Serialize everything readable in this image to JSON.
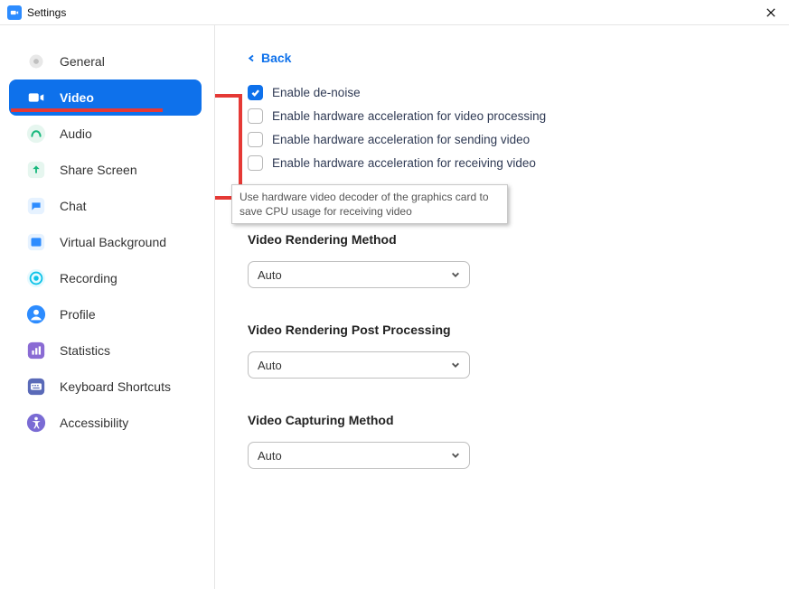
{
  "window": {
    "title": "Settings"
  },
  "sidebar": {
    "items": [
      {
        "label": "General",
        "icon": "gear"
      },
      {
        "label": "Video",
        "icon": "video",
        "active": true
      },
      {
        "label": "Audio",
        "icon": "audio"
      },
      {
        "label": "Share Screen",
        "icon": "share"
      },
      {
        "label": "Chat",
        "icon": "chat"
      },
      {
        "label": "Virtual Background",
        "icon": "vbg"
      },
      {
        "label": "Recording",
        "icon": "record"
      },
      {
        "label": "Profile",
        "icon": "profile"
      },
      {
        "label": "Statistics",
        "icon": "stats"
      },
      {
        "label": "Keyboard Shortcuts",
        "icon": "keyboard"
      },
      {
        "label": "Accessibility",
        "icon": "accessibility"
      }
    ]
  },
  "main": {
    "back_label": "Back",
    "checkboxes": [
      {
        "label": "Enable de-noise",
        "checked": true
      },
      {
        "label": "Enable hardware acceleration for video processing",
        "checked": false
      },
      {
        "label": "Enable hardware acceleration for sending video",
        "checked": false
      },
      {
        "label": "Enable hardware acceleration for receiving video",
        "checked": false
      }
    ],
    "tooltip": "Use hardware video decoder of the graphics card to save CPU usage for receiving video",
    "sections": [
      {
        "title": "Video Rendering Method",
        "value": "Auto"
      },
      {
        "title": "Video Rendering Post Processing",
        "value": "Auto"
      },
      {
        "title": "Video Capturing Method",
        "value": "Auto"
      }
    ]
  }
}
